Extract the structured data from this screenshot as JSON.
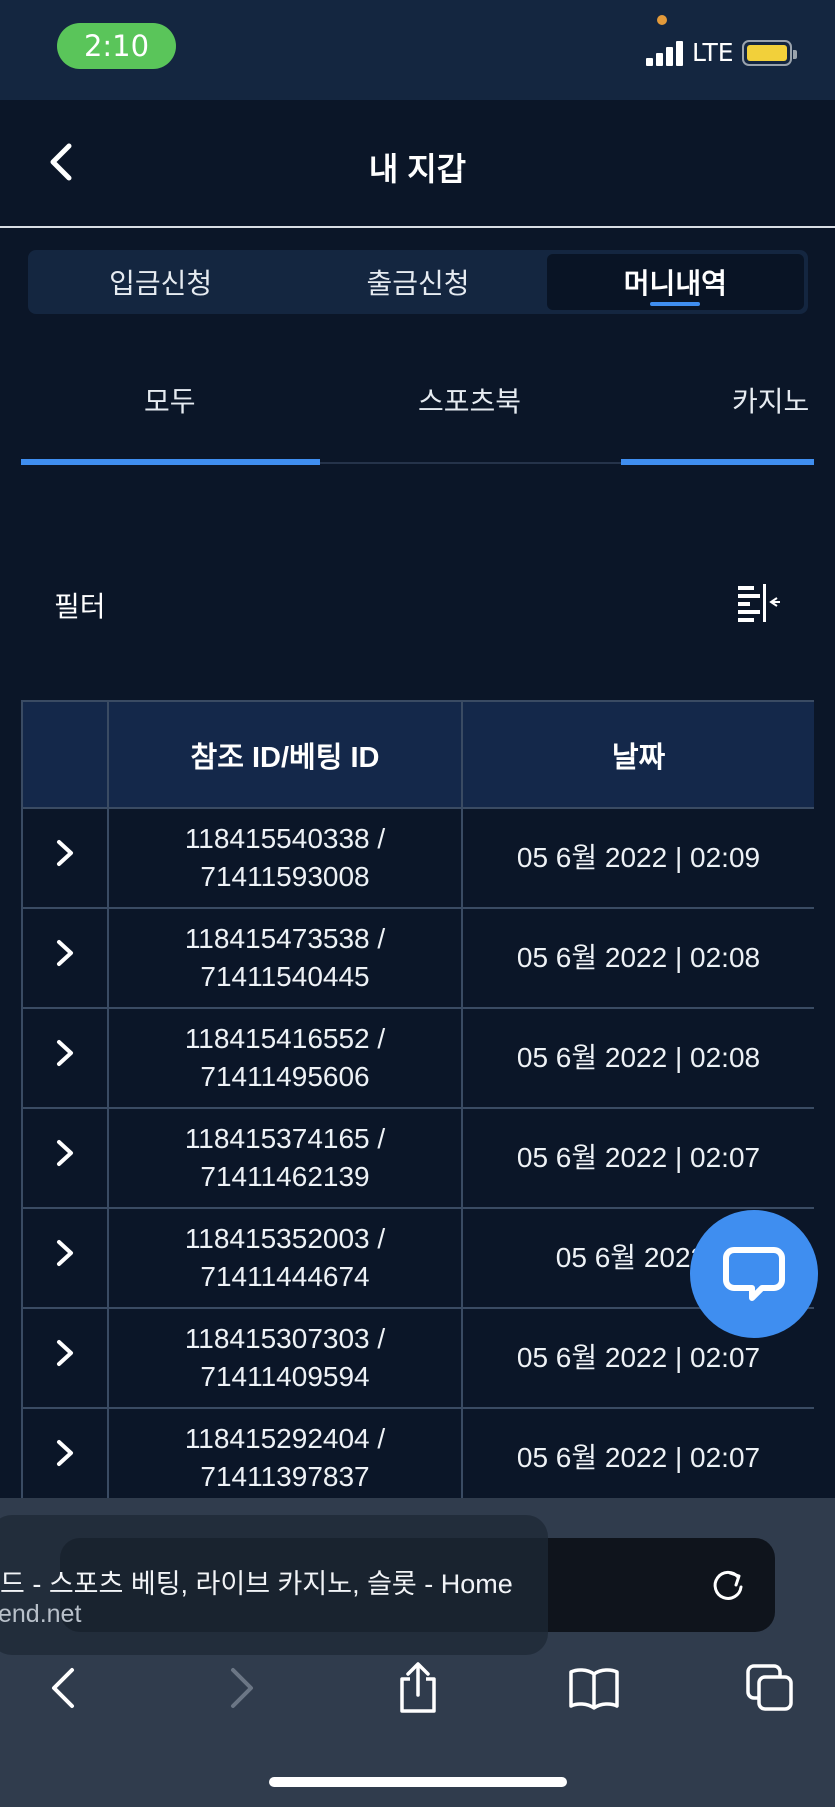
{
  "status_bar": {
    "time": "2:10",
    "network": "LTE"
  },
  "header": {
    "title": "내 지갑"
  },
  "tabs": [
    {
      "label": "입금신청",
      "active": false
    },
    {
      "label": "출금신청",
      "active": false
    },
    {
      "label": "머니내역",
      "active": true
    }
  ],
  "subtabs": [
    {
      "label": "모두",
      "active": true
    },
    {
      "label": "스포츠북",
      "active": false
    },
    {
      "label": "카지노",
      "active": true
    }
  ],
  "filter": {
    "label": "필터"
  },
  "table": {
    "headers": [
      "",
      "참조 ID/베팅 ID",
      "날짜"
    ],
    "rows": [
      {
        "ref_id": "118415540338 /",
        "bet_id": "71411593008",
        "date": "05 6월 2022 | 02:09"
      },
      {
        "ref_id": "118415473538 /",
        "bet_id": "71411540445",
        "date": "05 6월 2022 | 02:08"
      },
      {
        "ref_id": "118415416552 /",
        "bet_id": "71411495606",
        "date": "05 6월 2022 | 02:08"
      },
      {
        "ref_id": "118415374165 /",
        "bet_id": "71411462139",
        "date": "05 6월 2022 | 02:07"
      },
      {
        "ref_id": "118415352003 /",
        "bet_id": "71411444674",
        "date": "05 6월 2022 |"
      },
      {
        "ref_id": "118415307303 /",
        "bet_id": "71411409594",
        "date": "05 6월 2022 | 02:07"
      },
      {
        "ref_id": "118415292404 /",
        "bet_id": "71411397837",
        "date": "05 6월 2022 | 02:07"
      }
    ]
  },
  "browser": {
    "page_title": "드 - 스포츠 베팅, 라이브 카지노, 슬롯 - Home",
    "url": "end.net"
  },
  "colors": {
    "accent": "#3f8ef0",
    "background": "#0b1628",
    "header_row": "#14284a"
  }
}
